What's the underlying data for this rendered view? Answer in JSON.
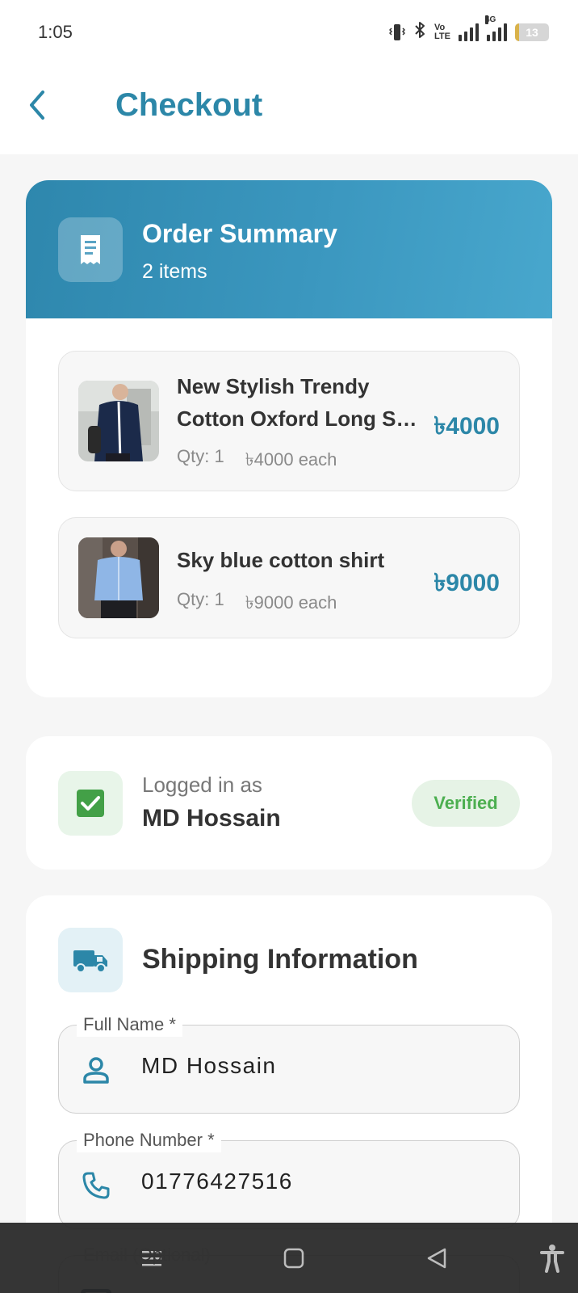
{
  "status_bar": {
    "time": "1:05",
    "volte_line1": "Vo",
    "volte_line2": "LTE",
    "network": "4G",
    "battery_level": "13",
    "battery_fraction": 0.13
  },
  "app_bar": {
    "title": "Checkout",
    "back_icon": "chevron-left-icon"
  },
  "order_summary": {
    "title": "Order Summary",
    "item_count": "2 items",
    "icon": "receipt-icon",
    "items": [
      {
        "name": "New Stylish Trendy Cotton Oxford Long S…",
        "qty": "Qty: 1",
        "unit_price": "৳4000 each",
        "total": "৳4000",
        "image": "navy-shirt-photo"
      },
      {
        "name": "Sky blue cotton shirt",
        "qty": "Qty: 1",
        "unit_price": "৳9000 each",
        "total": "৳9000",
        "image": "sky-blue-shirt-photo"
      }
    ]
  },
  "login": {
    "label": "Logged in as",
    "user": "MD Hossain",
    "badge": "Verified",
    "icon": "check-box-icon"
  },
  "shipping": {
    "title": "Shipping Information",
    "icon": "truck-icon",
    "fields": [
      {
        "label": "Full Name *",
        "value": "MD Hossain",
        "icon": "person-icon"
      },
      {
        "label": "Phone Number *",
        "value": "01776427516",
        "icon": "phone-icon"
      },
      {
        "label": "Email (Optional)",
        "value": "",
        "icon": "email-icon"
      }
    ]
  },
  "colors": {
    "accent": "#2c87a8",
    "header_gradient_start": "#2e87ad",
    "header_gradient_end": "#48a7cd",
    "success": "#4caf50"
  },
  "nav_bar": {
    "icons": [
      "menu-icon",
      "home-square-icon",
      "back-triangle-icon",
      "accessibility-icon"
    ]
  }
}
